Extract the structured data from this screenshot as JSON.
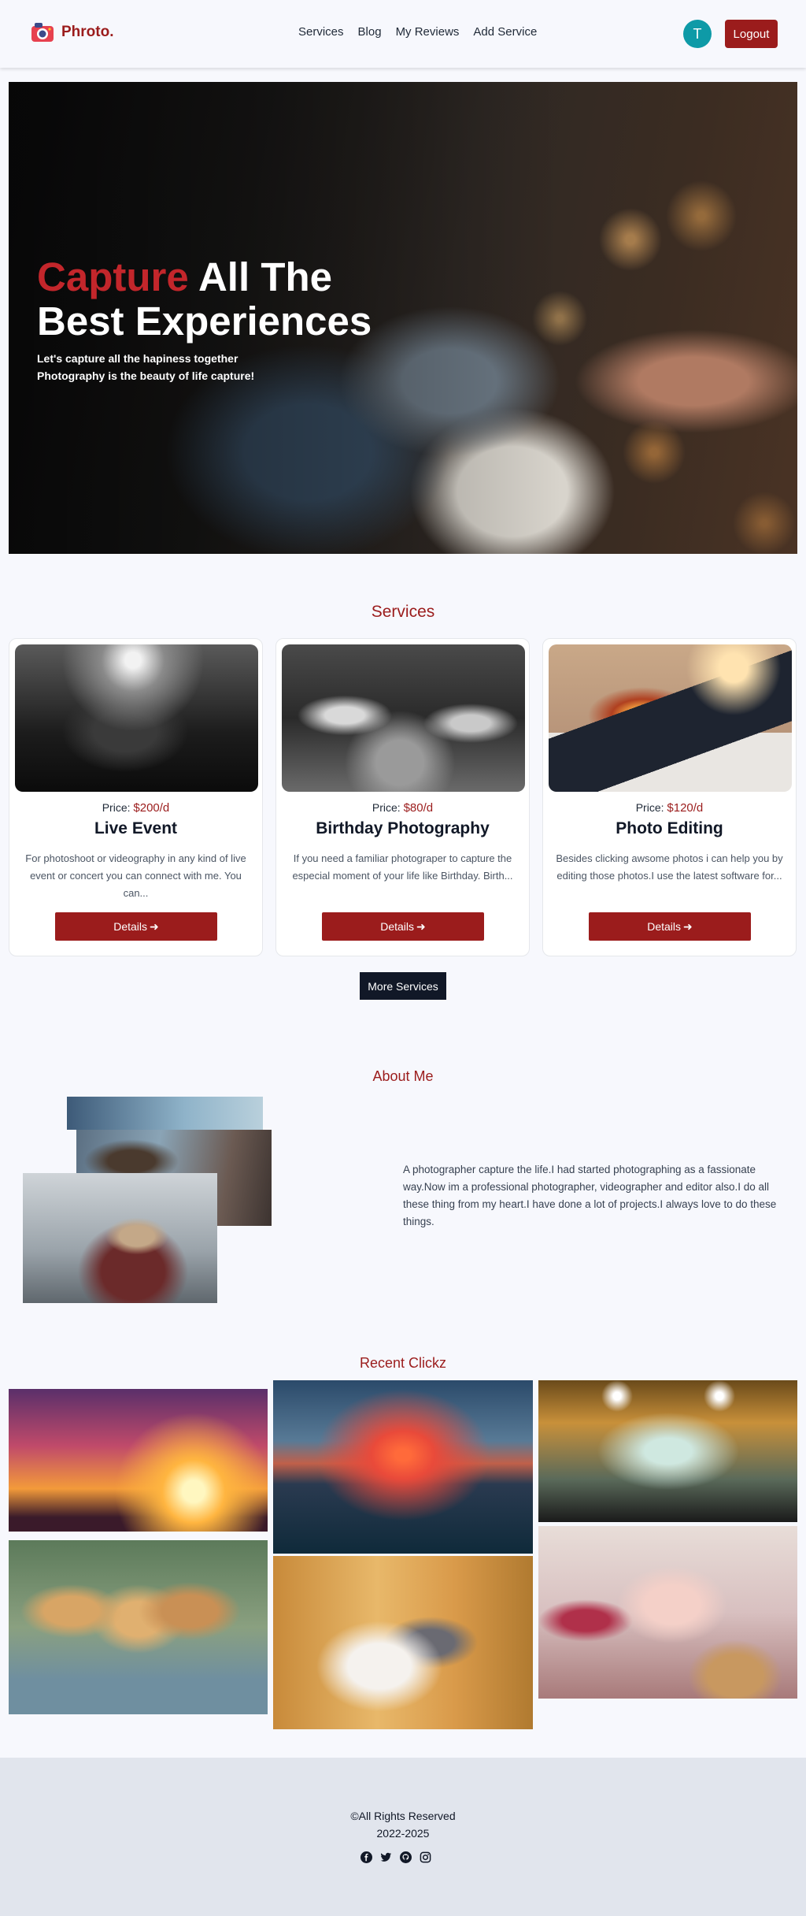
{
  "nav": {
    "brand": "Phroto.",
    "links": [
      "Services",
      "Blog",
      "My Reviews",
      "Add Service"
    ],
    "avatar_letter": "T",
    "logout_label": "Logout"
  },
  "hero": {
    "title_red": "Capture",
    "title_rest": " All The",
    "title_line2": "Best Experiences",
    "subtitle_line1": "Let's capture all the hapiness together",
    "subtitle_line2": "Photography is the beauty of life capture!"
  },
  "services": {
    "heading": "Services",
    "price_label": "Price: ",
    "items": [
      {
        "price": "$200/d",
        "title": "Live Event",
        "desc": "For photoshoot or videography in any kind of live event or concert you can connect with me. You can...",
        "button": "Details"
      },
      {
        "price": "$80/d",
        "title": "Birthday Photography",
        "desc": "If you need a familiar photograper to capture the especial moment of your life like Birthday. Birth...",
        "button": "Details"
      },
      {
        "price": "$120/d",
        "title": "Photo Editing",
        "desc": "Besides clicking awsome photos i can help you by editing those photos.I use the latest software for...",
        "button": "Details"
      }
    ],
    "more_label": "More Services"
  },
  "about": {
    "heading": "About Me",
    "text": "A photographer capture the life.I had started photographing as a fassionate way.Now im a professional photographer, videographer and editor also.I do all these thing from my heart.I have done a lot of projects.I always love to do these things."
  },
  "recent": {
    "heading": "Recent Clickz"
  },
  "footer": {
    "rights": "©All Rights Reserved",
    "years": "2022-2025",
    "social_icons": [
      "facebook-icon",
      "twitter-icon",
      "github-icon",
      "instagram-icon"
    ]
  },
  "colors": {
    "brand_red": "#9b1c1c",
    "hero_red": "#c3262b",
    "avatar_teal": "#0e9aa7",
    "dark_button": "#111827",
    "footer_bg": "#e1e5ed"
  }
}
